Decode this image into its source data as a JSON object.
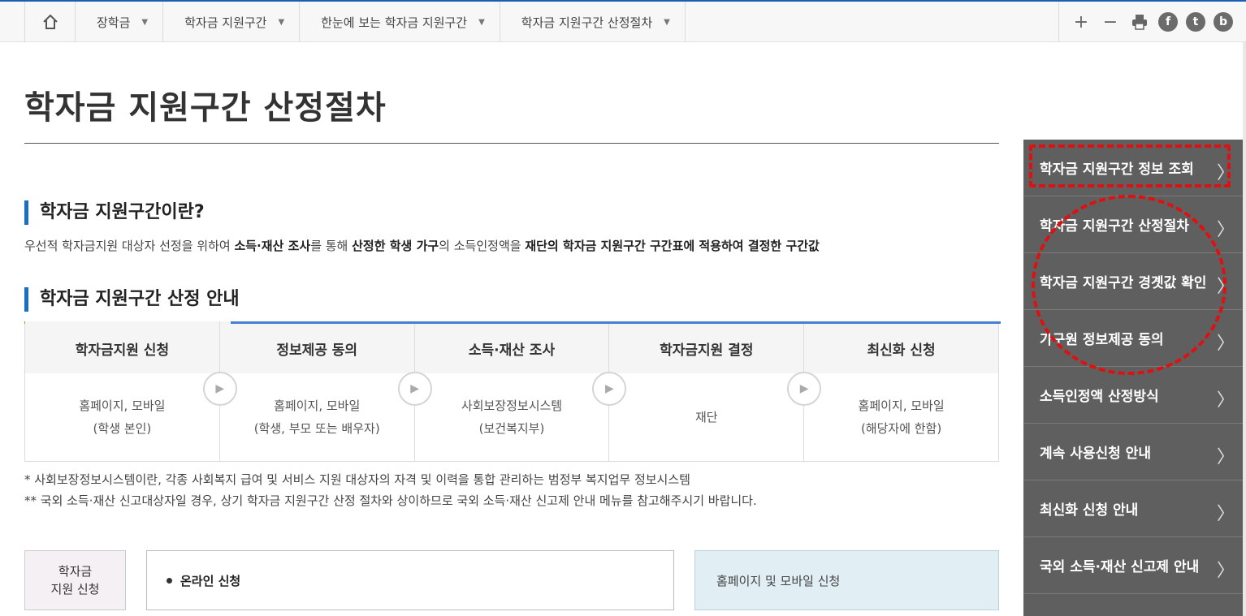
{
  "nav": {
    "breadcrumbs": [
      "장학금",
      "학자금 지원구간",
      "한눈에 보는 학자금 지원구간",
      "학자금 지원구간 산정절차"
    ],
    "tools": {
      "zoom_in": "+",
      "zoom_out": "−",
      "facebook": "f",
      "twitter": "t",
      "blog": "b"
    }
  },
  "page": {
    "title": "학자금 지원구간 산정절차",
    "section1_title": "학자금 지원구간이란?",
    "section2_title": "학자금 지원구간 산정 안내",
    "desc": {
      "p1": "우선적 학자금지원 대상자 선정을 위하여 ",
      "b1": "소득·재산 조사",
      "p2": "를 통해 ",
      "b2": "산정한 학생 가구",
      "p3": "의 소득인정액을 ",
      "b3": "재단의 학자금 지원구간 구간표에 적용하여 결정한 구간값"
    }
  },
  "steps": [
    {
      "title": "학자금지원 신청",
      "line1": "홈페이지, 모바일",
      "line2": "(학생 본인)"
    },
    {
      "title": "정보제공 동의",
      "line1": "홈페이지, 모바일",
      "line2": "(학생, 부모 또는 배우자)"
    },
    {
      "title": "소득·재산 조사",
      "line1": "사회보장정보시스템",
      "line2": "(보건복지부)"
    },
    {
      "title": "학자금지원 결정",
      "line1": "재단",
      "line2": ""
    },
    {
      "title": "최신화 신청",
      "line1": "홈페이지, 모바일",
      "line2": "(해당자에 한함)"
    }
  ],
  "notes": {
    "n1": "* 사회보장정보시스템이란, 각종 사회복지 급여 및 서비스 지원 대상자의 자격 및 이력을 통합 관리하는 범정부 복지업무 정보시스템",
    "n2": "** 국외 소득·재산 신고대상자일 경우, 상기 학자금 지원구간 산정 절차와 상이하므로 국외 소득·재산 신고제 안내 메뉴를 참고해주시기 바랍니다."
  },
  "apply": {
    "label_line1": "학자금",
    "label_line2": "지원 신청",
    "online": "온라인 신청",
    "site": "홈페이지 및 모바일 신청"
  },
  "sidebar": {
    "items": [
      "학자금 지원구간 정보 조회",
      "학자금 지원구간 산정절차",
      "학자금 지원구간 경곗값 확인",
      "가구원 정보제공 동의",
      "소득인정액 산정방식",
      "계속 사용신청 안내",
      "최신화 신청 안내",
      "국외 소득·재산 신고제 안내"
    ]
  },
  "colors": {
    "accent_blue": "#1a6fc4",
    "sidebar_bg": "#5f5f5f",
    "annotation_red": "#e01010",
    "step_green": "#6cb33f"
  }
}
